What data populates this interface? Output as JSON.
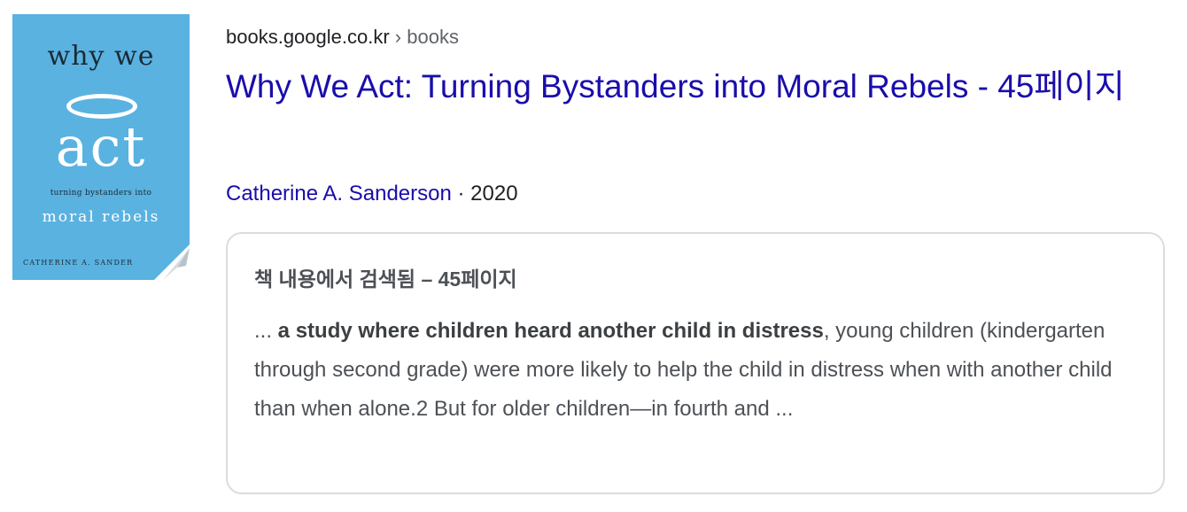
{
  "cover": {
    "why": "why we",
    "act": "act",
    "subtitle": "turning bystanders into",
    "moral": "moral rebels",
    "author": "CATHERINE A. SANDER",
    "background": "#5ab2e0"
  },
  "result": {
    "domain": "books.google.co.kr",
    "breadcrumb_sep": " › ",
    "breadcrumb": "books",
    "title": "Why We Act: Turning Bystanders into Moral Rebels - 45페이지",
    "author": "Catherine A. Sanderson",
    "dot": " · ",
    "year": "2020",
    "link_color": "#1a0dab"
  },
  "snippet": {
    "heading": "책 내용에서 검색됨 – 45페이지",
    "prefix": "... ",
    "highlight": "a study where children heard another child in distress",
    "rest": ", young children (kindergarten through second grade) were more likely to help the child in distress when with another child than when alone.2 But for older children—in fourth and ..."
  }
}
